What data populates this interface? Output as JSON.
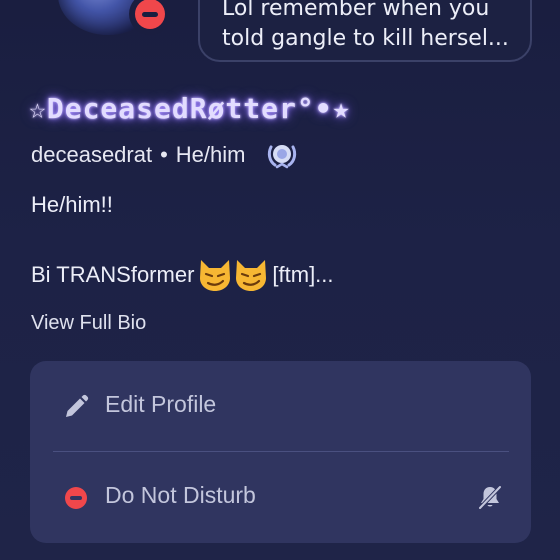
{
  "status": {
    "avatar_status": "do-not-disturb",
    "dnd_color": "#f0474b",
    "bubble_text": "Lol remember when you\ntold gangle to kill hersel..."
  },
  "profile": {
    "display_name": "☆DeceasedRøtter°•★",
    "username": "deceasedrat",
    "separator": "•",
    "pronouns": "He/him",
    "badge_icon": "laurel-badge-icon",
    "bio_line1": "He/him!!",
    "bio_line2_text": "Bi TRANSformer",
    "bio_line2_emoji": "smirking-cat-emoji",
    "bio_line2_suffix": "[ftm]...",
    "view_bio_label": "View Full Bio"
  },
  "actions": {
    "edit_profile_label": "Edit Profile",
    "dnd_label": "Do Not Disturb",
    "edit_icon": "pencil-icon",
    "dnd_icon": "dnd-status-icon",
    "mute_icon": "bell-off-icon"
  },
  "colors": {
    "background": "#1c2144",
    "card": "#303560",
    "name_glow": "#a58cff"
  }
}
